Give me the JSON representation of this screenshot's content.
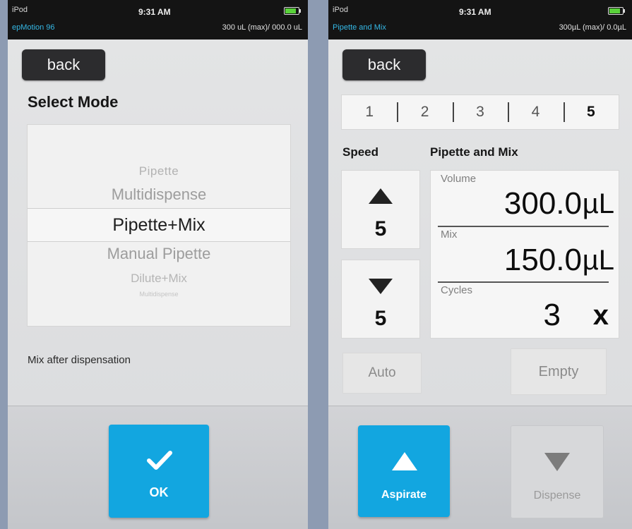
{
  "left": {
    "status": {
      "device": "iPod",
      "time": "9:31 AM",
      "app": "epMotion 96",
      "volume_info": "300 uL (max)/ 000.0 uL"
    },
    "back_label": "back",
    "title": "Select Mode",
    "modes": [
      "Pipette",
      "Multidispense",
      "Pipette+Mix",
      "Manual Pipette",
      "Dilute+Mix",
      "Multidispense"
    ],
    "selected_mode": "Pipette+Mix",
    "description": "Mix after dispensation",
    "ok_label": "OK"
  },
  "right": {
    "status": {
      "device": "iPod",
      "time": "9:31 AM",
      "app": "Pipette and Mix",
      "volume_info": "300µL (max)/   0.0µL"
    },
    "back_label": "back",
    "steps": [
      "1",
      "2",
      "3",
      "4",
      "5"
    ],
    "active_step": "5",
    "speed_label": "Speed",
    "mode_label": "Pipette and Mix",
    "speed_up_value": "5",
    "speed_down_value": "5",
    "volume": {
      "label": "Volume",
      "value": "300.0",
      "unit": "µL"
    },
    "mix": {
      "label": "Mix",
      "value": "150.0",
      "unit": "µL"
    },
    "cycles": {
      "label": "Cycles",
      "value": "3",
      "unit": "x"
    },
    "auto_label": "Auto",
    "empty_label": "Empty",
    "aspirate_label": "Aspirate",
    "dispense_label": "Dispense"
  },
  "colors": {
    "accent": "#12a6e0",
    "status_bar": "#141414",
    "battery": "#59d23a"
  }
}
